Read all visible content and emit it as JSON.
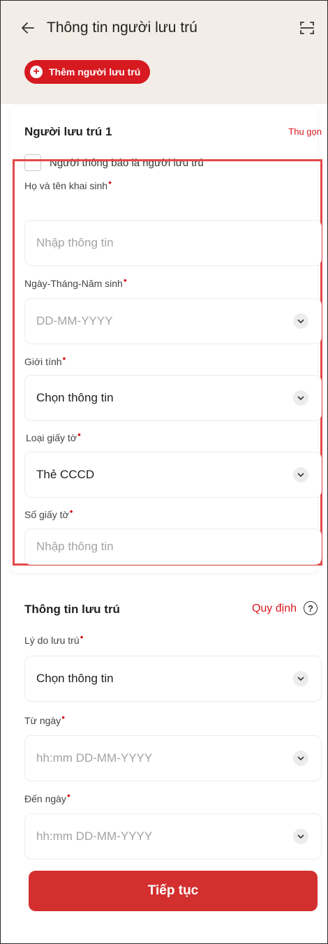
{
  "header": {
    "back_icon": "arrow-left-icon",
    "title": "Thông tin người lưu trú",
    "scan_icon": "scan-icon",
    "add_button_label": "Thêm người lưu trú"
  },
  "guest_section": {
    "title": "Người lưu trú 1",
    "collapse_label": "Thu gọn",
    "notifier_checkbox_label": "Người thông báo là người lưu trú",
    "fields": [
      {
        "label": "Họ và tên khai sinh",
        "required": "•",
        "placeholder": "Nhập thông tin",
        "value": ""
      },
      {
        "label": "Ngày-Tháng-Năm sinh",
        "required": "•",
        "placeholder": "DD-MM-YYYY",
        "value": ""
      },
      {
        "label": "Giới tính",
        "required": "•",
        "placeholder": "",
        "value": "Chọn thông tin"
      },
      {
        "label": "Loại giấy tờ",
        "required": "•",
        "placeholder": "",
        "value": "Thẻ CCCD"
      },
      {
        "label": "Số giấy tờ",
        "required": "•",
        "placeholder": "Nhập thông tin",
        "value": ""
      }
    ]
  },
  "stay_section": {
    "title": "Thông tin lưu trú",
    "rule_link": "Quy định",
    "help_icon": "question-circle-icon",
    "fields": [
      {
        "label": "Lý do lưu trú",
        "required": "•",
        "placeholder": "",
        "value": "Chọn thông tin"
      },
      {
        "label": "Từ ngày",
        "required": "•",
        "placeholder": "hh:mm DD-MM-YYYY",
        "value": ""
      },
      {
        "label": "Đến ngày",
        "required": "•",
        "placeholder": "hh:mm DD-MM-YYYY",
        "value": ""
      }
    ]
  },
  "footer": {
    "continue_label": "Tiếp tục"
  },
  "colors": {
    "accent": "#d71920",
    "highlight_border": "#e24a4a",
    "header_bg": "#f2ede6"
  }
}
